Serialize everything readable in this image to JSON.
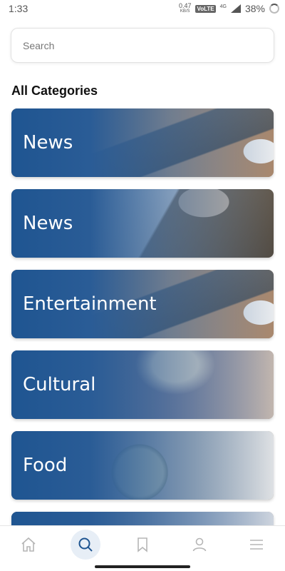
{
  "status_bar": {
    "time": "1:33",
    "net_speed": "0.47",
    "net_unit": "KB/S",
    "volte": "VoLTE",
    "network": "4G",
    "battery": "38%"
  },
  "search": {
    "placeholder": "Search",
    "value": ""
  },
  "section_title": "All Categories",
  "categories": [
    {
      "label": "News",
      "image": "phone-laptop-photo"
    },
    {
      "label": "News",
      "image": "building-photo"
    },
    {
      "label": "Entertainment",
      "image": "phone-laptop-photo"
    },
    {
      "label": "Cultural",
      "image": "person-photo"
    },
    {
      "label": "Food",
      "image": "food-bowl-photo"
    },
    {
      "label": "",
      "image": "partial-card-photo"
    }
  ],
  "bottom_nav": {
    "active": "search",
    "items": [
      "home-icon",
      "search-icon",
      "bookmark-icon",
      "profile-icon",
      "menu-icon"
    ]
  },
  "colors": {
    "card_overlay": "#1f5591",
    "active_nav": "#1f5591",
    "icon_gray": "#b5b5b5"
  }
}
